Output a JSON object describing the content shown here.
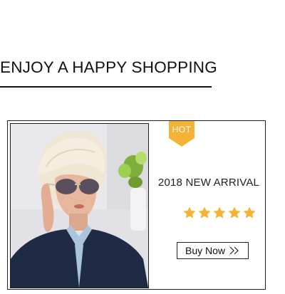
{
  "headline": "ENJOY A HAPPY SHOPPING",
  "promo": {
    "badge": "HOT",
    "title": "2018 NEW ARRIVAL",
    "rating": 5,
    "rating_max": 5,
    "button_label": "Buy Now",
    "button_icon": "double-chevron-right-icon"
  },
  "colors": {
    "badge": "#f5b335",
    "star": "#f5b335",
    "text": "#111111"
  }
}
